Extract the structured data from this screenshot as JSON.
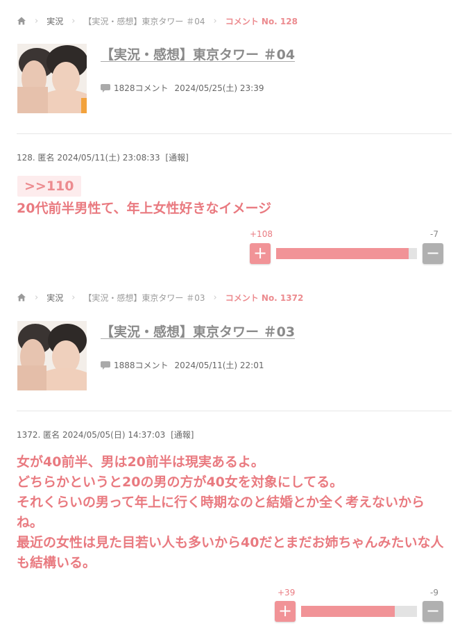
{
  "colors": {
    "accent": "#ec8b8f",
    "comment_text": "#e97a80",
    "plus_button": "#f19397",
    "minus_button": "#b0b0b0"
  },
  "sections": [
    {
      "breadcrumb": {
        "home_icon": "home-icon",
        "category": "実況",
        "topic": "【実況・感想】東京タワー ＃04",
        "current": "コメント No. 128"
      },
      "topic": {
        "title": "【実況・感想】東京タワー ＃04",
        "comment_count": "1828コメント",
        "date": "2024/05/25(土) 23:39",
        "icon": "speech-bubble-icon"
      },
      "comment": {
        "header": "128. 匿名 2024/05/11(土) 23:08:33",
        "report": "[通報]",
        "anchor": ">>110",
        "body": [
          "20代前半男性て、年上女性好きなイメージ"
        ],
        "plus_count": "+108",
        "minus_count": "-7",
        "plus_label": "+",
        "minus_label": "−",
        "plus_ratio": 0.94
      }
    },
    {
      "breadcrumb": {
        "home_icon": "home-icon",
        "category": "実況",
        "topic": "【実況・感想】東京タワー ＃03",
        "current": "コメント No. 1372"
      },
      "topic": {
        "title": "【実況・感想】東京タワー ＃03",
        "comment_count": "1888コメント",
        "date": "2024/05/11(土) 22:01",
        "icon": "speech-bubble-icon"
      },
      "comment": {
        "header": "1372. 匿名 2024/05/05(日) 14:37:03",
        "report": "[通報]",
        "body": [
          "女が40前半、男は20前半は現実あるよ。",
          "どちらかというと20の男の方が40女を対象にしてる。",
          "それくらいの男って年上に行く時期なのと結婚とか全く考えないからね。",
          "最近の女性は見た目若い人も多いから40だとまだお姉ちゃんみたいな人も結構いる。"
        ],
        "plus_count": "+39",
        "minus_count": "-9",
        "plus_label": "+",
        "minus_label": "−",
        "plus_ratio": 0.81
      }
    }
  ]
}
